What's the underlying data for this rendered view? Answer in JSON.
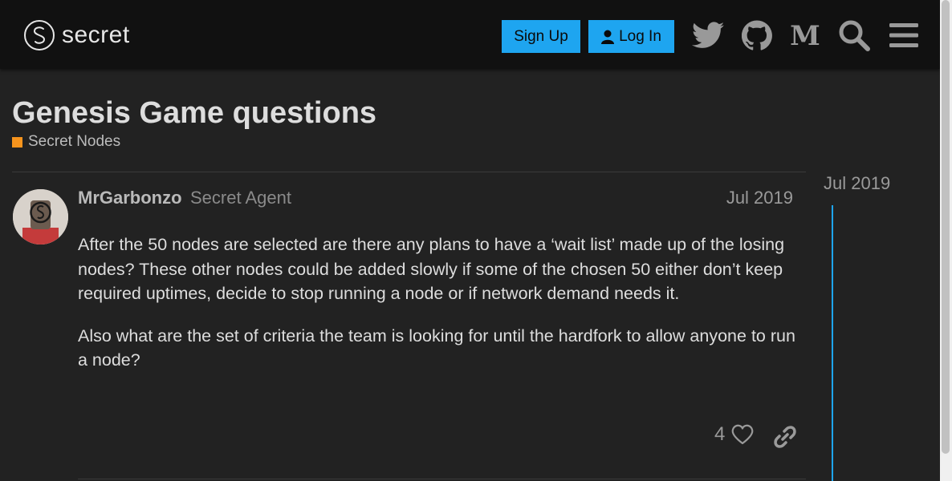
{
  "header": {
    "logo_text": "secret",
    "signup_label": "Sign Up",
    "login_label": "Log In",
    "icons": [
      "twitter-icon",
      "github-icon",
      "medium-icon",
      "search-icon",
      "menu-icon"
    ]
  },
  "topic": {
    "title": "Genesis Game questions",
    "category": "Secret Nodes",
    "category_color": "#f7941d"
  },
  "post": {
    "username": "MrGarbonzo",
    "user_title": "Secret Agent",
    "date": "Jul 2019",
    "paragraphs": [
      "After the 50 nodes are selected are there any plans to have a ‘wait list’ made up of the losing nodes? These other nodes could be added slowly if some of the chosen 50 either don’t keep required uptimes, decide to stop running a node or if network demand needs it.",
      "Also what are the set of criteria the team is looking for until the hardfork to allow anyone to run a node?"
    ],
    "like_count": "4"
  },
  "timeline": {
    "date": "Jul 2019"
  },
  "colors": {
    "accent": "#1ea5f0",
    "background": "#222222",
    "header": "#111111"
  }
}
